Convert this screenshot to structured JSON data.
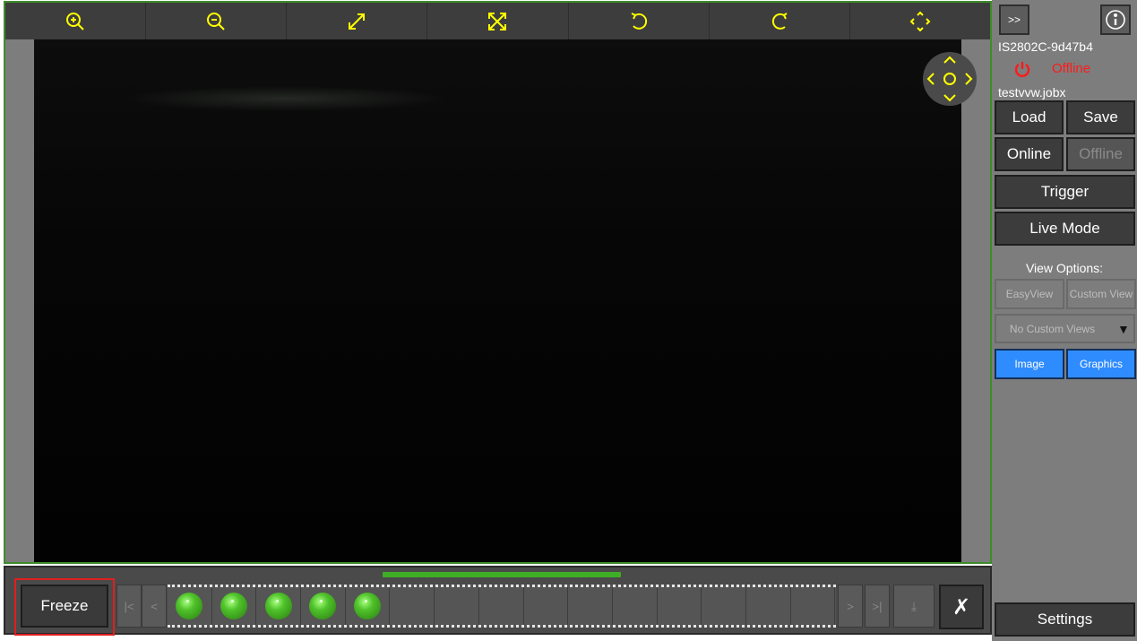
{
  "toolbar": {
    "buttons": [
      {
        "icon": "zoom-in-icon"
      },
      {
        "icon": "zoom-out-icon"
      },
      {
        "icon": "fit-icon"
      },
      {
        "icon": "fill-icon"
      },
      {
        "icon": "rotate-left-icon"
      },
      {
        "icon": "rotate-right-icon"
      },
      {
        "icon": "pan-icon"
      }
    ],
    "icon_color": "#ffff00"
  },
  "pan_control": {
    "icon": "directional-pad-icon"
  },
  "filmstrip": {
    "freeze_label": "Freeze",
    "nav_first": "|<",
    "nav_prev": "<",
    "nav_next": ">",
    "nav_last": ">|",
    "download_label": "⤓",
    "close_label": "✗",
    "frames_with_results": 5,
    "total_frames": 15,
    "progress_color": "#3fae27"
  },
  "panel": {
    "expand_label": ">>",
    "info_icon": "info-icon",
    "device_name": "IS2802C-9d47b4",
    "status": "Offline",
    "status_color": "#ff1a1a",
    "job_name": "testvvw.jobx",
    "load_label": "Load",
    "save_label": "Save",
    "online_label": "Online",
    "offline_label": "Offline",
    "trigger_label": "Trigger",
    "live_mode_label": "Live Mode",
    "view_options_label": "View Options:",
    "easyview_label": "EasyView",
    "custom_view_label": "Custom View",
    "custom_views_select": "No Custom Views",
    "image_label": "Image",
    "graphics_label": "Graphics",
    "settings_label": "Settings",
    "accent_blue": "#2f8cff"
  }
}
